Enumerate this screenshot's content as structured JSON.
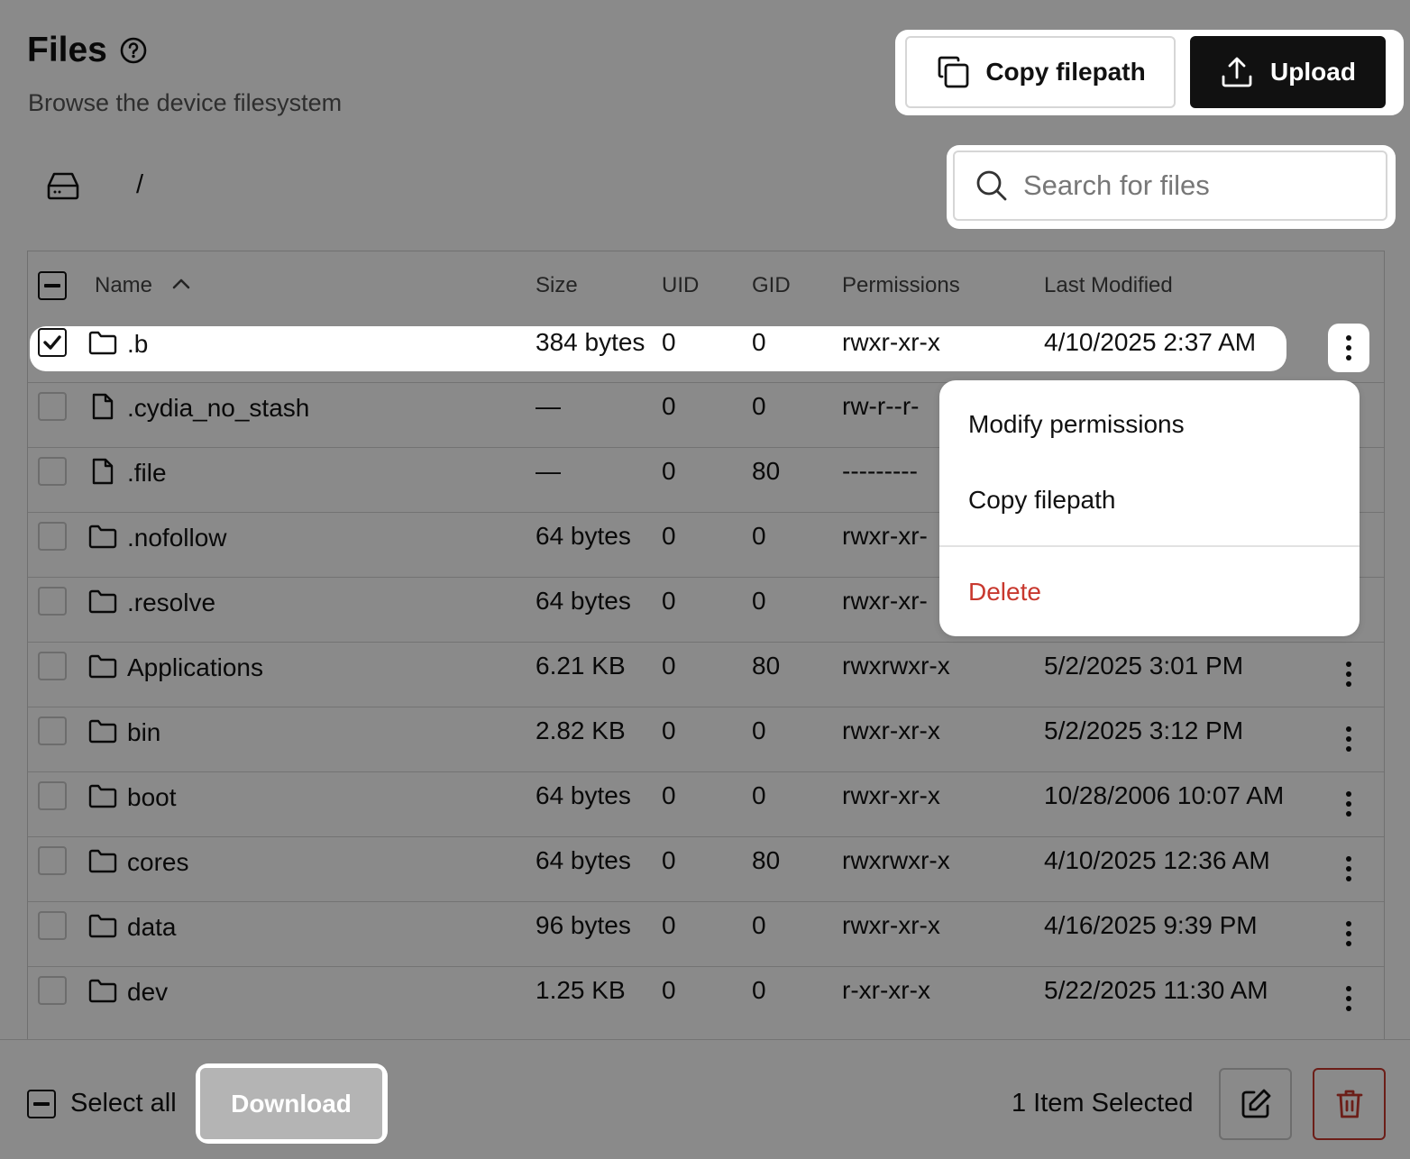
{
  "header": {
    "title": "Files",
    "subtitle": "Browse the device filesystem",
    "copy_filepath_label": "Copy filepath",
    "upload_label": "Upload"
  },
  "breadcrumb": {
    "path": "/"
  },
  "search": {
    "placeholder": "Search for files"
  },
  "table": {
    "columns": [
      "Name",
      "Size",
      "UID",
      "GID",
      "Permissions",
      "Last Modified"
    ],
    "sort": {
      "column": "Name",
      "direction": "ascending"
    },
    "rows": [
      {
        "name": ".b",
        "type": "folder",
        "size": "384 bytes",
        "uid": "0",
        "gid": "0",
        "perm": "rwxr-xr-x",
        "modified": "4/10/2025 2:37 AM",
        "selected": true
      },
      {
        "name": ".cydia_no_stash",
        "type": "file",
        "size": "—",
        "uid": "0",
        "gid": "0",
        "perm": "rw-r--r-",
        "modified": "",
        "selected": false
      },
      {
        "name": ".file",
        "type": "file",
        "size": "—",
        "uid": "0",
        "gid": "80",
        "perm": "---------",
        "modified": "",
        "selected": false
      },
      {
        "name": ".nofollow",
        "type": "folder",
        "size": "64 bytes",
        "uid": "0",
        "gid": "0",
        "perm": "rwxr-xr-",
        "modified": "",
        "selected": false
      },
      {
        "name": ".resolve",
        "type": "folder",
        "size": "64 bytes",
        "uid": "0",
        "gid": "0",
        "perm": "rwxr-xr-",
        "modified": "",
        "selected": false
      },
      {
        "name": "Applications",
        "type": "folder",
        "size": "6.21 KB",
        "uid": "0",
        "gid": "80",
        "perm": "rwxrwxr-x",
        "modified": "5/2/2025 3:01 PM",
        "selected": false
      },
      {
        "name": "bin",
        "type": "folder",
        "size": "2.82 KB",
        "uid": "0",
        "gid": "0",
        "perm": "rwxr-xr-x",
        "modified": "5/2/2025 3:12 PM",
        "selected": false
      },
      {
        "name": "boot",
        "type": "folder",
        "size": "64 bytes",
        "uid": "0",
        "gid": "0",
        "perm": "rwxr-xr-x",
        "modified": "10/28/2006 10:07 AM",
        "selected": false
      },
      {
        "name": "cores",
        "type": "folder",
        "size": "64 bytes",
        "uid": "0",
        "gid": "80",
        "perm": "rwxrwxr-x",
        "modified": "4/10/2025 12:36 AM",
        "selected": false
      },
      {
        "name": "data",
        "type": "folder",
        "size": "96 bytes",
        "uid": "0",
        "gid": "0",
        "perm": "rwxr-xr-x",
        "modified": "4/16/2025 9:39 PM",
        "selected": false
      },
      {
        "name": "dev",
        "type": "folder",
        "size": "1.25 KB",
        "uid": "0",
        "gid": "0",
        "perm": "r-xr-xr-x",
        "modified": "5/22/2025 11:30 AM",
        "selected": false
      }
    ]
  },
  "context_menu": {
    "items": [
      "Modify permissions",
      "Copy filepath",
      "Delete"
    ]
  },
  "footer": {
    "select_all_label": "Select all",
    "download_label": "Download",
    "selected_count": "1 Item Selected"
  },
  "colors": {
    "primary": "#111111",
    "danger": "#c8382e",
    "overlay": "rgba(0,0,0,0.46)",
    "disabled": "#b4b4b4"
  },
  "icons": {
    "help": "help-circle-icon",
    "copy": "copy-icon",
    "upload": "upload-icon",
    "search": "search-icon",
    "drive": "hard-drive-icon",
    "sort": "chevron-up-icon",
    "folder": "folder-icon",
    "file": "file-icon",
    "more": "more-vertical-icon",
    "edit": "edit-icon",
    "delete": "trash-icon"
  }
}
